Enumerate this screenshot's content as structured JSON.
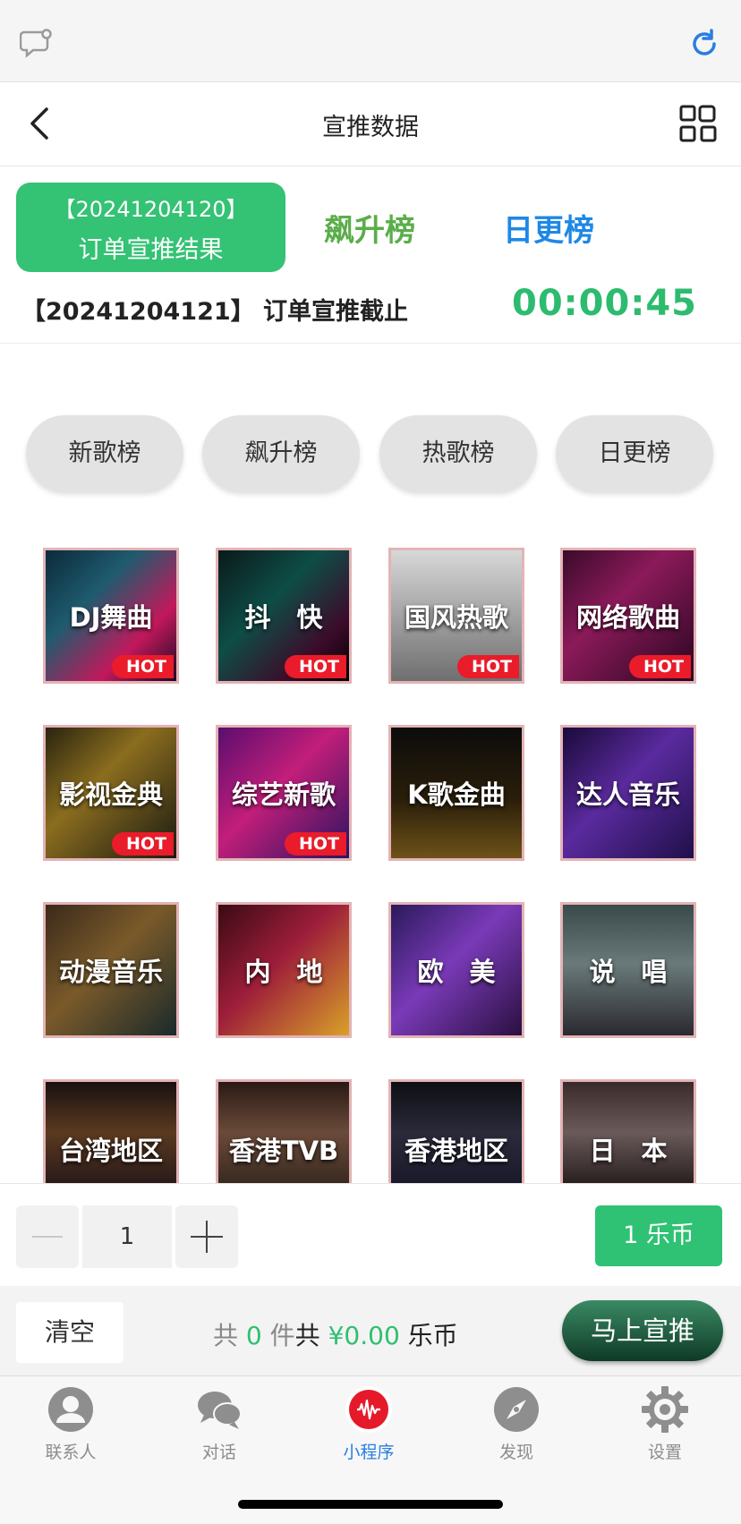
{
  "nav": {
    "title": "宣推数据"
  },
  "header": {
    "result_line1": "【20241204120】",
    "result_line2": "订单宣推结果",
    "tab_rise": "飙升榜",
    "tab_daily": "日更榜",
    "deadline_text": "【20241204121】 订单宣推截止",
    "countdown": "00:00:45"
  },
  "filters": [
    "新歌榜",
    "飙升榜",
    "热歌榜",
    "日更榜"
  ],
  "categories": [
    {
      "label": "DJ舞曲",
      "hot": true,
      "bg": "linear-gradient(135deg,#0b2a3a 0%,#1e5b6e 35%,#c2185b 70%,#1a0a24 100%)"
    },
    {
      "label": "抖　快",
      "hot": true,
      "bg": "linear-gradient(135deg,#0a1a1a 0%,#0e4d47 40%,#3b0c2a 75%,#000 100%)"
    },
    {
      "label": "国风热歌",
      "hot": true,
      "bg": "linear-gradient(180deg,#d8d8d8 0%,#a8a8a8 45%,#6f6f6f 100%)"
    },
    {
      "label": "网络歌曲",
      "hot": true,
      "bg": "linear-gradient(135deg,#3a0a2a 0%,#8b1a5a 40%,#2a0620 100%)"
    },
    {
      "label": "影视金典",
      "hot": true,
      "bg": "linear-gradient(135deg,#2a2410 0%,#8a6d1e 40%,#1b1a12 100%)"
    },
    {
      "label": "综艺新歌",
      "hot": true,
      "bg": "linear-gradient(135deg,#5a0e6e 0%,#c21e7a 45%,#2a1460 100%)"
    },
    {
      "label": "K歌金曲",
      "hot": false,
      "bg": "linear-gradient(180deg,#0c0c0c 0%,#2a1e0a 55%,#6e5218 100%)"
    },
    {
      "label": "达人音乐",
      "hot": false,
      "bg": "linear-gradient(135deg,#1a0a3a 0%,#5a2a9e 45%,#20104a 100%)"
    },
    {
      "label": "动漫音乐",
      "hot": false,
      "bg": "linear-gradient(135deg,#3a2a1a 0%,#7a5a2a 45%,#1a2a2a 100%)"
    },
    {
      "label": "内　地",
      "hot": false,
      "bg": "linear-gradient(135deg,#3a0a14 0%,#9e1e3a 45%,#d8a028 100%)"
    },
    {
      "label": "欧　美",
      "hot": false,
      "bg": "linear-gradient(135deg,#2a1a5a 0%,#7a3ab8 45%,#2a1040 100%)"
    },
    {
      "label": "说　唱",
      "hot": false,
      "bg": "linear-gradient(180deg,#3a4a4a 0%,#6a7a7a 45%,#2a2a30 100%)"
    },
    {
      "label": "台湾地区",
      "hot": false,
      "bg": "linear-gradient(180deg,#1a1010 0%,#5a3a20 50%,#2a1a1a 100%)"
    },
    {
      "label": "香港TVB",
      "hot": false,
      "bg": "linear-gradient(180deg,#2a1a14 0%,#6a4a3a 50%,#3a2a20 100%)"
    },
    {
      "label": "香港地区",
      "hot": false,
      "bg": "linear-gradient(180deg,#0e0e14 0%,#2a2a3a 50%,#1a1a2a 100%)"
    },
    {
      "label": "日　本",
      "hot": false,
      "bg": "linear-gradient(180deg,#3a2a2a 0%,#6a5a5a 50%,#2a2020 100%)"
    }
  ],
  "hot_badge": "HOT",
  "quantity": {
    "value": "1",
    "coin_label": "1 乐币"
  },
  "summary": {
    "clear_label": "清空",
    "prefix": "共",
    "count": "0",
    "unit": "件",
    "middle": "共",
    "amount": "¥0.00",
    "currency": "乐币",
    "submit_label": "马上宣推"
  },
  "tabbar": {
    "items": [
      {
        "label": "联系人",
        "icon": "contact-icon"
      },
      {
        "label": "对话",
        "icon": "chat-bubbles-icon"
      },
      {
        "label": "小程序",
        "icon": "mini-program-icon"
      },
      {
        "label": "发现",
        "icon": "compass-icon"
      },
      {
        "label": "设置",
        "icon": "gear-icon"
      }
    ],
    "active_index": 2
  },
  "colors": {
    "accent_green": "#34c274",
    "countdown_green": "#2dbb6f",
    "rise_green": "#5aae4a",
    "daily_blue": "#1e88e5",
    "hot_red": "#ea1b2a"
  }
}
